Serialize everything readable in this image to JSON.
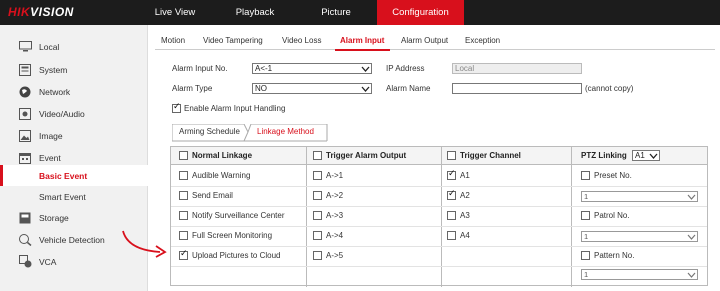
{
  "header": {
    "logo_red": "HIK",
    "logo_white": "VISION",
    "nav": [
      {
        "label": "Live View"
      },
      {
        "label": "Playback"
      },
      {
        "label": "Picture"
      },
      {
        "label": "Configuration",
        "active": true
      }
    ]
  },
  "sidebar": {
    "items": [
      {
        "label": "Local",
        "icon": "monitor-icon"
      },
      {
        "label": "System",
        "icon": "system-icon"
      },
      {
        "label": "Network",
        "icon": "globe-icon"
      },
      {
        "label": "Video/Audio",
        "icon": "video-audio-icon"
      },
      {
        "label": "Image",
        "icon": "image-icon"
      },
      {
        "label": "Event",
        "icon": "calendar-icon"
      },
      {
        "label": "Basic Event",
        "sub": true,
        "active": true
      },
      {
        "label": "Smart Event",
        "sub": true
      },
      {
        "label": "Storage",
        "icon": "storage-icon"
      },
      {
        "label": "Vehicle Detection",
        "icon": "vehicle-icon"
      },
      {
        "label": "VCA",
        "icon": "vca-icon"
      }
    ]
  },
  "tabs": [
    "Motion",
    "Video Tampering",
    "Video Loss",
    "Alarm Input",
    "Alarm Output",
    "Exception"
  ],
  "active_tab": "Alarm Input",
  "form": {
    "alarm_input_no_label": "Alarm Input No.",
    "alarm_input_no_value": "A<-1",
    "ip_address_label": "IP Address",
    "ip_address_value": "Local",
    "alarm_type_label": "Alarm Type",
    "alarm_type_value": "NO",
    "alarm_name_label": "Alarm Name",
    "alarm_name_value": "",
    "cannot_copy": "(cannot copy)",
    "enable_label": "Enable Alarm Input Handling",
    "enable_checked": true
  },
  "subtabs": [
    "Arming Schedule",
    "Linkage Method"
  ],
  "active_subtab": "Linkage Method",
  "linkage": {
    "headers": {
      "normal": "Normal Linkage",
      "trigger_alarm_output": "Trigger Alarm Output",
      "trigger_channel": "Trigger Channel",
      "ptz_linking": "PTZ Linking",
      "ptz_select": "A1"
    },
    "normal": [
      {
        "label": "Audible Warning",
        "checked": false
      },
      {
        "label": "Send Email",
        "checked": false
      },
      {
        "label": "Notify Surveillance Center",
        "checked": false
      },
      {
        "label": "Full Screen Monitoring",
        "checked": false
      },
      {
        "label": "Upload Pictures to Cloud",
        "checked": true
      }
    ],
    "alarm_outputs": [
      {
        "label": "A->1",
        "checked": false
      },
      {
        "label": "A->2",
        "checked": false
      },
      {
        "label": "A->3",
        "checked": false
      },
      {
        "label": "A->4",
        "checked": false
      },
      {
        "label": "A->5",
        "checked": false
      }
    ],
    "channels": [
      {
        "label": "A1",
        "checked": true
      },
      {
        "label": "A2",
        "checked": true
      },
      {
        "label": "A3",
        "checked": false
      },
      {
        "label": "A4",
        "checked": false
      }
    ],
    "ptz": [
      {
        "label": "Preset No.",
        "value": "1"
      },
      {
        "label": "Patrol No.",
        "value": "1"
      },
      {
        "label": "Pattern No.",
        "value": "1"
      }
    ]
  },
  "colors": {
    "accent": "#d8101c",
    "topbar": "#1c1c1c",
    "sidebar": "#f1f1f1"
  }
}
